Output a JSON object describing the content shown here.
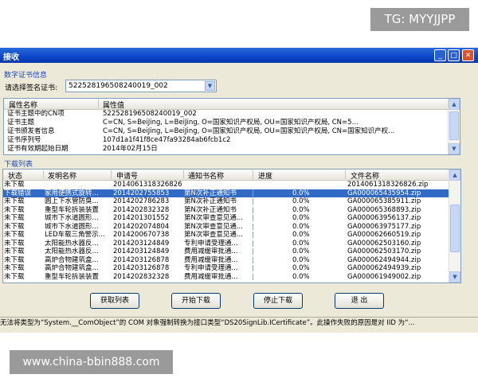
{
  "watermarks": {
    "top": "TG: MYYJJPP",
    "bottom": "www.china-bbin888.com"
  },
  "window": {
    "title": "接收"
  },
  "cert_section": {
    "title": "数字证书信息",
    "select_label": "请选择签名证书:",
    "select_value": "522528196508240019_002",
    "columns": [
      "属性名称",
      "属性值"
    ],
    "rows": [
      {
        "name": "证书主题中的CN项",
        "value": "522528196508240019_002"
      },
      {
        "name": "证书主题",
        "value": "C=CN, S=BeiJing, L=BeiJing, O=国家知识产权局, OU=国家知识产权局, CN=5..."
      },
      {
        "name": "证书颁发者信息",
        "value": "C=CN, S=BeiJing, L=BeiJing, O=国家知识产权局, OU=国家知识产权局, CN=国家知识产权..."
      },
      {
        "name": "证书序列号",
        "value": "107d1a1f41f8ce47fa93284ab6fcb1c2"
      },
      {
        "name": "证书有效期起始日期",
        "value": "2014年02月15日"
      }
    ]
  },
  "download_section": {
    "title": "下载列表",
    "columns": [
      "状态",
      "发明名称",
      "申请号",
      "通知书名称",
      "进度",
      "文件名称"
    ],
    "rows": [
      {
        "status": "未下载",
        "name": "",
        "app_no": "2014061318326826",
        "notice": "",
        "progress": "",
        "file": "2014061318326826.zip"
      },
      {
        "status": "下载错误",
        "name": "家用便携式旋转...",
        "app_no": "2014202755853",
        "notice": "第N次补正通知书",
        "progress": "0.0%",
        "file": "GA000065435954.zip"
      },
      {
        "status": "未下载",
        "name": "圆上下水管防臭...",
        "app_no": "2014202786283",
        "notice": "第N次补正通知书",
        "progress": "0.0%",
        "file": "GA000065385911.zip"
      },
      {
        "status": "未下载",
        "name": "重型车轮拆装装置",
        "app_no": "2014202832328",
        "notice": "第N次补正通知书",
        "progress": "0.0%",
        "file": "GA000065368893.zip"
      },
      {
        "status": "未下载",
        "name": "城市下水道圆形...",
        "app_no": "2014201301552",
        "notice": "第N次审查意见通...",
        "progress": "0.0%",
        "file": "GA000063956137.zip"
      },
      {
        "status": "未下载",
        "name": "城市下水道圆形...",
        "app_no": "2014202074804",
        "notice": "第N次审查意见通...",
        "progress": "0.0%",
        "file": "GA000063975177.zip"
      },
      {
        "status": "未下载",
        "name": "LED车载三角警示...",
        "app_no": "2014200670738",
        "notice": "第N次审查意见通...",
        "progress": "0.0%",
        "file": "GA000062660519.zip"
      },
      {
        "status": "未下载",
        "name": "太阳能热水器反...",
        "app_no": "2014203124849",
        "notice": "专利申请受理通...",
        "progress": "0.0%",
        "file": "GA000062503160.zip"
      },
      {
        "status": "未下载",
        "name": "太阳能热水器反...",
        "app_no": "2014203124849",
        "notice": "费用减缓审批通...",
        "progress": "0.0%",
        "file": "GA000062503170.zip"
      },
      {
        "status": "未下载",
        "name": "高炉合物建筑盒...",
        "app_no": "2014203126878",
        "notice": "费用减缓审批通...",
        "progress": "0.0%",
        "file": "GA000062494944.zip"
      },
      {
        "status": "未下载",
        "name": "高炉合物建筑盒...",
        "app_no": "2014203126878",
        "notice": "专利申请受理通...",
        "progress": "0.0%",
        "file": "GA000062494939.zip"
      },
      {
        "status": "未下载",
        "name": "重型车轮拆装装置",
        "app_no": "2014202832328",
        "notice": "费用减缓审批通...",
        "progress": "0.0%",
        "file": "GA000061949002.zip"
      }
    ]
  },
  "buttons": {
    "fetch": "获取列表",
    "start": "开始下载",
    "stop": "停止下载",
    "exit": "退 出"
  },
  "status_bar": "无法将类型为“System.__ComObject”的 COM 对象强制转换为接口类型“DS20SignLib.ICertificate”。此操作失败的原因是对 IID 为“..."
}
